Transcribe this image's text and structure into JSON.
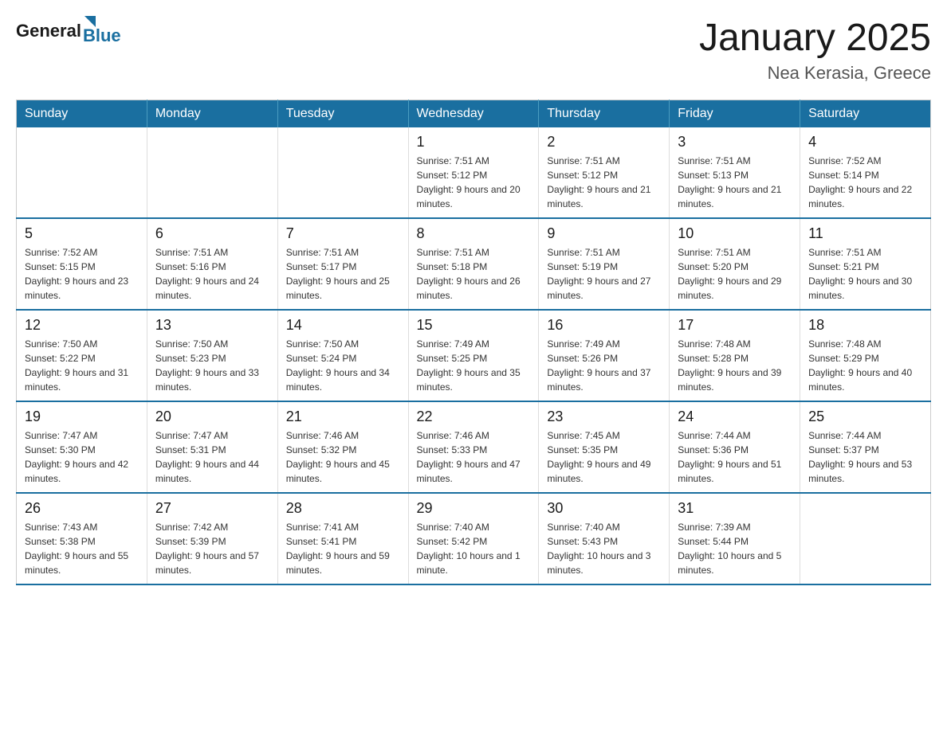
{
  "header": {
    "logo_general": "General",
    "logo_blue": "Blue",
    "title": "January 2025",
    "subtitle": "Nea Kerasia, Greece"
  },
  "weekdays": [
    "Sunday",
    "Monday",
    "Tuesday",
    "Wednesday",
    "Thursday",
    "Friday",
    "Saturday"
  ],
  "weeks": [
    [
      {
        "day": "",
        "sunrise": "",
        "sunset": "",
        "daylight": ""
      },
      {
        "day": "",
        "sunrise": "",
        "sunset": "",
        "daylight": ""
      },
      {
        "day": "",
        "sunrise": "",
        "sunset": "",
        "daylight": ""
      },
      {
        "day": "1",
        "sunrise": "Sunrise: 7:51 AM",
        "sunset": "Sunset: 5:12 PM",
        "daylight": "Daylight: 9 hours and 20 minutes."
      },
      {
        "day": "2",
        "sunrise": "Sunrise: 7:51 AM",
        "sunset": "Sunset: 5:12 PM",
        "daylight": "Daylight: 9 hours and 21 minutes."
      },
      {
        "day": "3",
        "sunrise": "Sunrise: 7:51 AM",
        "sunset": "Sunset: 5:13 PM",
        "daylight": "Daylight: 9 hours and 21 minutes."
      },
      {
        "day": "4",
        "sunrise": "Sunrise: 7:52 AM",
        "sunset": "Sunset: 5:14 PM",
        "daylight": "Daylight: 9 hours and 22 minutes."
      }
    ],
    [
      {
        "day": "5",
        "sunrise": "Sunrise: 7:52 AM",
        "sunset": "Sunset: 5:15 PM",
        "daylight": "Daylight: 9 hours and 23 minutes."
      },
      {
        "day": "6",
        "sunrise": "Sunrise: 7:51 AM",
        "sunset": "Sunset: 5:16 PM",
        "daylight": "Daylight: 9 hours and 24 minutes."
      },
      {
        "day": "7",
        "sunrise": "Sunrise: 7:51 AM",
        "sunset": "Sunset: 5:17 PM",
        "daylight": "Daylight: 9 hours and 25 minutes."
      },
      {
        "day": "8",
        "sunrise": "Sunrise: 7:51 AM",
        "sunset": "Sunset: 5:18 PM",
        "daylight": "Daylight: 9 hours and 26 minutes."
      },
      {
        "day": "9",
        "sunrise": "Sunrise: 7:51 AM",
        "sunset": "Sunset: 5:19 PM",
        "daylight": "Daylight: 9 hours and 27 minutes."
      },
      {
        "day": "10",
        "sunrise": "Sunrise: 7:51 AM",
        "sunset": "Sunset: 5:20 PM",
        "daylight": "Daylight: 9 hours and 29 minutes."
      },
      {
        "day": "11",
        "sunrise": "Sunrise: 7:51 AM",
        "sunset": "Sunset: 5:21 PM",
        "daylight": "Daylight: 9 hours and 30 minutes."
      }
    ],
    [
      {
        "day": "12",
        "sunrise": "Sunrise: 7:50 AM",
        "sunset": "Sunset: 5:22 PM",
        "daylight": "Daylight: 9 hours and 31 minutes."
      },
      {
        "day": "13",
        "sunrise": "Sunrise: 7:50 AM",
        "sunset": "Sunset: 5:23 PM",
        "daylight": "Daylight: 9 hours and 33 minutes."
      },
      {
        "day": "14",
        "sunrise": "Sunrise: 7:50 AM",
        "sunset": "Sunset: 5:24 PM",
        "daylight": "Daylight: 9 hours and 34 minutes."
      },
      {
        "day": "15",
        "sunrise": "Sunrise: 7:49 AM",
        "sunset": "Sunset: 5:25 PM",
        "daylight": "Daylight: 9 hours and 35 minutes."
      },
      {
        "day": "16",
        "sunrise": "Sunrise: 7:49 AM",
        "sunset": "Sunset: 5:26 PM",
        "daylight": "Daylight: 9 hours and 37 minutes."
      },
      {
        "day": "17",
        "sunrise": "Sunrise: 7:48 AM",
        "sunset": "Sunset: 5:28 PM",
        "daylight": "Daylight: 9 hours and 39 minutes."
      },
      {
        "day": "18",
        "sunrise": "Sunrise: 7:48 AM",
        "sunset": "Sunset: 5:29 PM",
        "daylight": "Daylight: 9 hours and 40 minutes."
      }
    ],
    [
      {
        "day": "19",
        "sunrise": "Sunrise: 7:47 AM",
        "sunset": "Sunset: 5:30 PM",
        "daylight": "Daylight: 9 hours and 42 minutes."
      },
      {
        "day": "20",
        "sunrise": "Sunrise: 7:47 AM",
        "sunset": "Sunset: 5:31 PM",
        "daylight": "Daylight: 9 hours and 44 minutes."
      },
      {
        "day": "21",
        "sunrise": "Sunrise: 7:46 AM",
        "sunset": "Sunset: 5:32 PM",
        "daylight": "Daylight: 9 hours and 45 minutes."
      },
      {
        "day": "22",
        "sunrise": "Sunrise: 7:46 AM",
        "sunset": "Sunset: 5:33 PM",
        "daylight": "Daylight: 9 hours and 47 minutes."
      },
      {
        "day": "23",
        "sunrise": "Sunrise: 7:45 AM",
        "sunset": "Sunset: 5:35 PM",
        "daylight": "Daylight: 9 hours and 49 minutes."
      },
      {
        "day": "24",
        "sunrise": "Sunrise: 7:44 AM",
        "sunset": "Sunset: 5:36 PM",
        "daylight": "Daylight: 9 hours and 51 minutes."
      },
      {
        "day": "25",
        "sunrise": "Sunrise: 7:44 AM",
        "sunset": "Sunset: 5:37 PM",
        "daylight": "Daylight: 9 hours and 53 minutes."
      }
    ],
    [
      {
        "day": "26",
        "sunrise": "Sunrise: 7:43 AM",
        "sunset": "Sunset: 5:38 PM",
        "daylight": "Daylight: 9 hours and 55 minutes."
      },
      {
        "day": "27",
        "sunrise": "Sunrise: 7:42 AM",
        "sunset": "Sunset: 5:39 PM",
        "daylight": "Daylight: 9 hours and 57 minutes."
      },
      {
        "day": "28",
        "sunrise": "Sunrise: 7:41 AM",
        "sunset": "Sunset: 5:41 PM",
        "daylight": "Daylight: 9 hours and 59 minutes."
      },
      {
        "day": "29",
        "sunrise": "Sunrise: 7:40 AM",
        "sunset": "Sunset: 5:42 PM",
        "daylight": "Daylight: 10 hours and 1 minute."
      },
      {
        "day": "30",
        "sunrise": "Sunrise: 7:40 AM",
        "sunset": "Sunset: 5:43 PM",
        "daylight": "Daylight: 10 hours and 3 minutes."
      },
      {
        "day": "31",
        "sunrise": "Sunrise: 7:39 AM",
        "sunset": "Sunset: 5:44 PM",
        "daylight": "Daylight: 10 hours and 5 minutes."
      },
      {
        "day": "",
        "sunrise": "",
        "sunset": "",
        "daylight": ""
      }
    ]
  ]
}
